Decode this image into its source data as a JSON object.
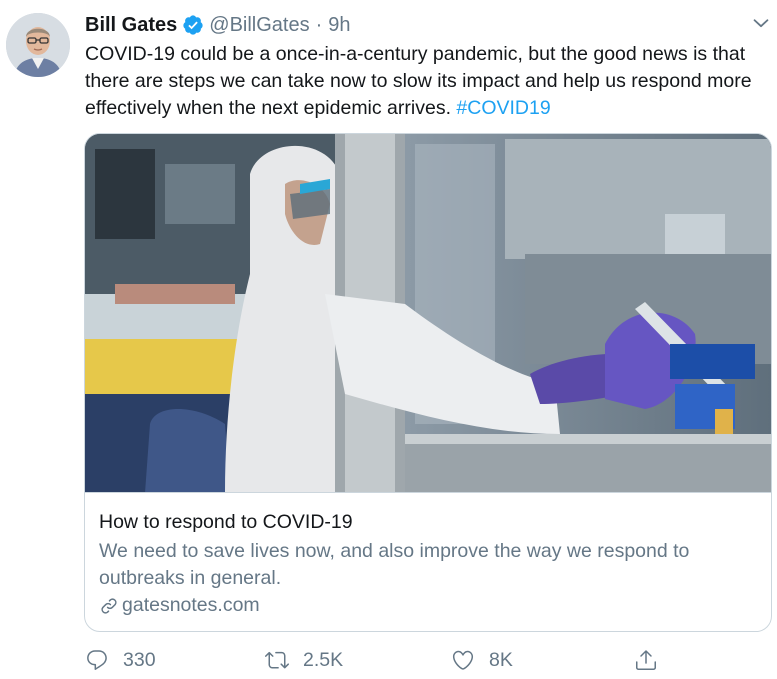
{
  "tweet": {
    "author_name": "Bill Gates",
    "handle": "@BillGates",
    "separator": "·",
    "time": "9h",
    "text": "COVID-19 could be a once-in-a-century pandemic, but the good news is that there are steps we can take now to slow its impact and help us respond more effectively when the next epidemic arrives. ",
    "hashtag": "#COVID19"
  },
  "card": {
    "title": "How to respond to COVID-19",
    "description": "We need to save lives now, and also improve the way we respond to outbreaks in general.",
    "domain": "gatesnotes.com"
  },
  "actions": {
    "reply_count": "330",
    "retweet_count": "2.5K",
    "like_count": "8K"
  },
  "icons": {
    "avatar": "avatar",
    "verified": "verified-badge-icon",
    "more": "chevron-down-icon",
    "link": "link-icon",
    "reply": "reply-icon",
    "retweet": "retweet-icon",
    "like": "heart-icon",
    "share": "share-icon"
  },
  "colors": {
    "accent": "#1da1f2",
    "secondary_text": "#657786",
    "border": "#ccd6dd"
  }
}
